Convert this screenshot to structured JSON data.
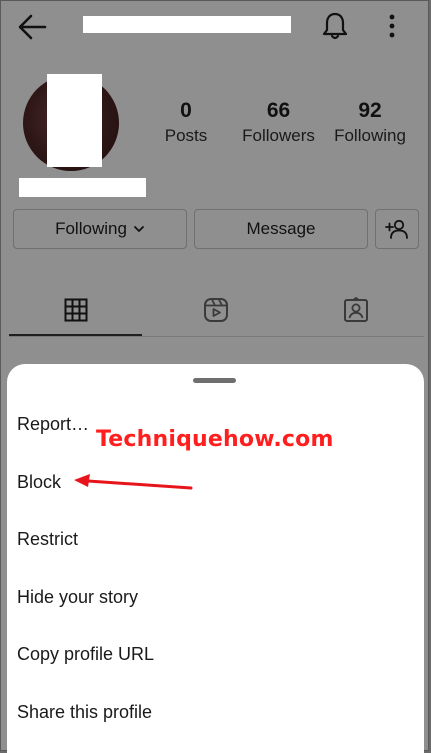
{
  "stats": {
    "posts": {
      "value": "0",
      "label": "Posts"
    },
    "followers": {
      "value": "66",
      "label": "Followers"
    },
    "following": {
      "value": "92",
      "label": "Following"
    }
  },
  "buttons": {
    "following_label": "Following",
    "message_label": "Message"
  },
  "tabs": [
    "grid-icon",
    "reels-icon",
    "tagged-icon"
  ],
  "sheet": {
    "items": [
      {
        "label": "Report…"
      },
      {
        "label": "Block"
      },
      {
        "label": "Restrict"
      },
      {
        "label": "Hide your story"
      },
      {
        "label": "Copy profile URL"
      },
      {
        "label": "Share this profile"
      }
    ]
  },
  "annotation": {
    "watermark": "Techniquehow.com",
    "arrow_color": "#e8141b"
  }
}
